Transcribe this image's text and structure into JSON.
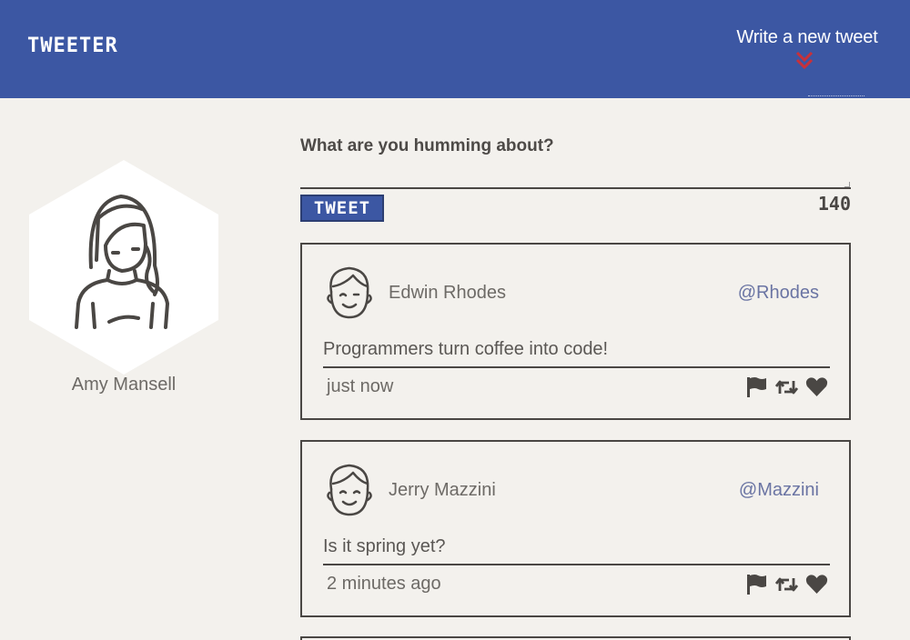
{
  "nav": {
    "brand": "TWEETER",
    "compose_label": "Write a new tweet"
  },
  "profile": {
    "name": "Amy Mansell"
  },
  "composer": {
    "prompt": "What are you humming about?",
    "input_value": "",
    "button_label": "TWEET",
    "counter": "140"
  },
  "tweets": [
    {
      "name": "Edwin Rhodes",
      "handle": "@Rhodes",
      "text": "Programmers turn coffee into code!",
      "time": "just now"
    },
    {
      "name": "Jerry Mazzini",
      "handle": "@Mazzini",
      "text": "Is it spring yet?",
      "time": "2 minutes ago"
    }
  ],
  "icons": {
    "brand_color": "#3c57a3",
    "accent_arrow": "#c8313a",
    "actions": [
      "flag-icon",
      "retweet-icon",
      "heart-icon"
    ]
  }
}
